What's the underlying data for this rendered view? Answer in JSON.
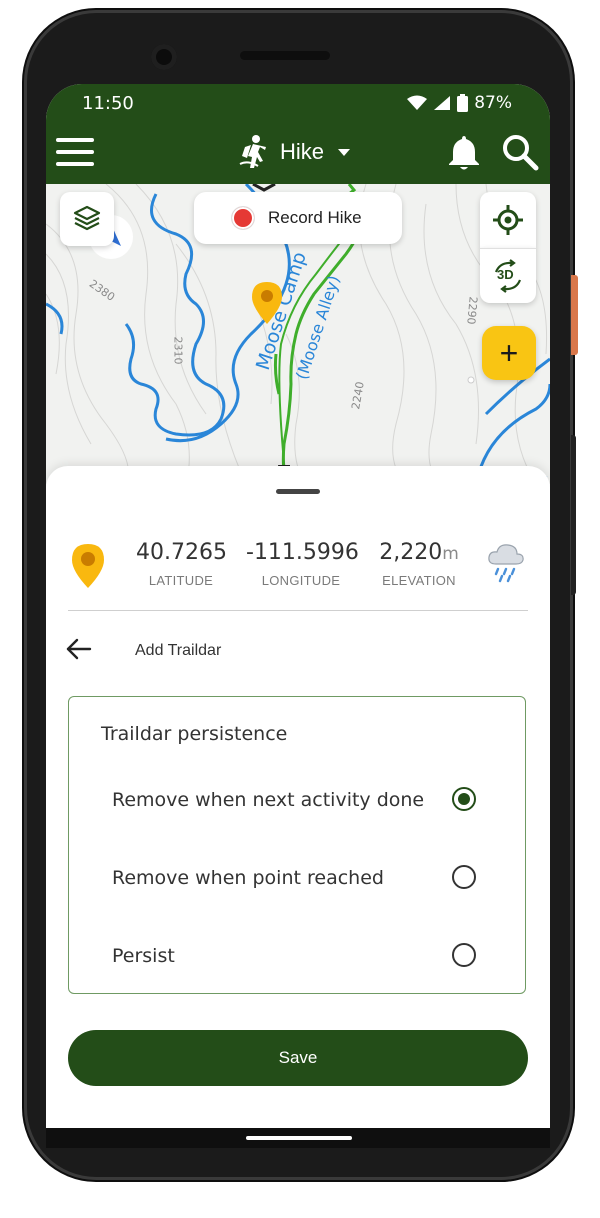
{
  "status": {
    "time": "11:50",
    "battery": "87%"
  },
  "appbar": {
    "activity": "Hike",
    "icons": [
      "menu-icon",
      "hiker-icon",
      "bell-icon",
      "search-icon"
    ]
  },
  "map": {
    "record_label": "Record Hike",
    "contour_labels": [
      "2380",
      "2310",
      "2240",
      "2290"
    ],
    "trail_labels": [
      "Moose Camp",
      "(Moose Alley)"
    ],
    "button_3d": "3D",
    "plus_label": "+",
    "colors": {
      "trail": "#3fae2b",
      "river": "#2a86d8",
      "pin": "#f9b80f",
      "fab": "#f9c513"
    }
  },
  "coords": {
    "latitude_value": "40.7265",
    "latitude_label": "LATITUDE",
    "longitude_value": "-111.5996",
    "longitude_label": "LONGITUDE",
    "elevation_value": "2,220",
    "elevation_unit": "m",
    "elevation_label": "ELEVATION"
  },
  "sheet": {
    "title": "Add Traildar",
    "panel_title": "Traildar persistence",
    "options": [
      {
        "label": "Remove when next activity done",
        "selected": true
      },
      {
        "label": "Remove when point reached",
        "selected": false
      },
      {
        "label": "Persist",
        "selected": false
      }
    ],
    "save_label": "Save"
  },
  "colors": {
    "brand": "#234d18",
    "border": "#6f9a63"
  }
}
